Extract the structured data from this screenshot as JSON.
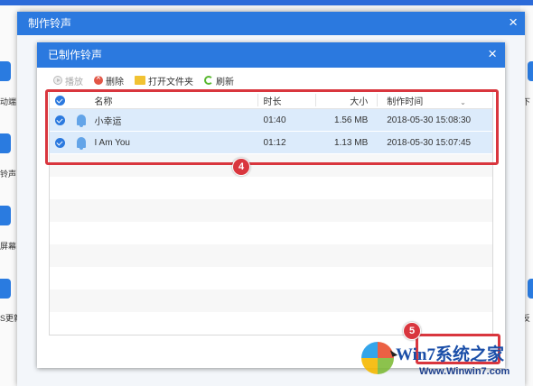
{
  "outer_dialog": {
    "title": "制作铃声",
    "close_label": "×"
  },
  "inner_dialog": {
    "title": "已制作铃声",
    "close_label": "×"
  },
  "background_labels": [
    "动端",
    "铃声",
    "屏幕",
    "S更新",
    "下",
    "反"
  ],
  "toolbar": {
    "play_label": "播放",
    "delete_label": "删除",
    "open_folder_label": "打开文件夹",
    "refresh_label": "刷新"
  },
  "table": {
    "columns": {
      "name": "名称",
      "duration": "时长",
      "size": "大小",
      "created": "制作时间"
    },
    "rows": [
      {
        "name": "小幸运",
        "duration": "01:40",
        "size": "1.56 MB",
        "created": "2018-05-30 15:08:30"
      },
      {
        "name": "I Am You",
        "duration": "01:12",
        "size": "1.13 MB",
        "created": "2018-05-30 15:07:45"
      }
    ]
  },
  "annotations": {
    "badge_1": "4",
    "badge_2": "5"
  },
  "watermark": {
    "brand": "Win7系统之家",
    "url": "Www.Winwin7.com"
  },
  "colors": {
    "accent": "#2b79df",
    "annotation_red": "#d9363e"
  }
}
